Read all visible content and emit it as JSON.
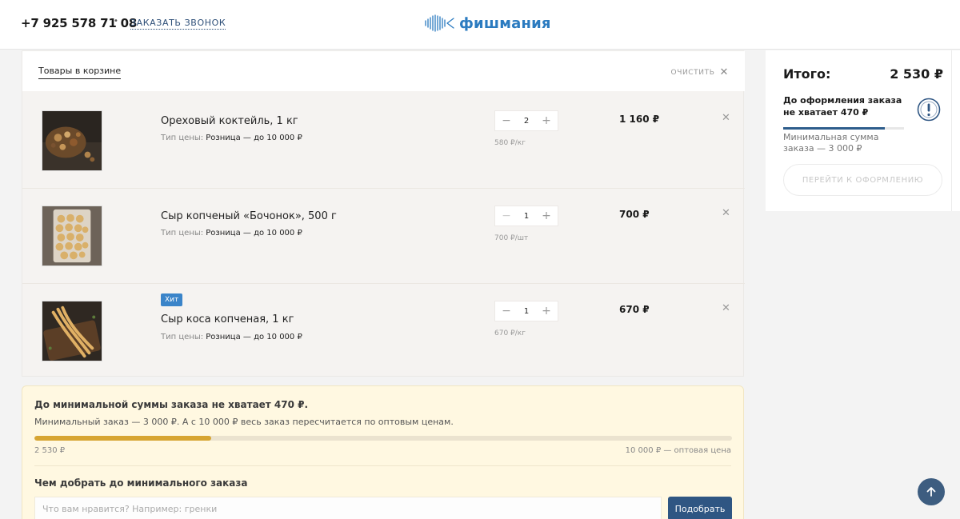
{
  "header": {
    "phone": "+7 925 578 71 08",
    "callback_label": "ЗАКАЗАТЬ ЗВОНОК",
    "logo_text": "фишмания",
    "brand_color": "#2b7bc0"
  },
  "cart": {
    "title": "Товары в корзине",
    "clear_label": "ОЧИСТИТЬ",
    "items": [
      {
        "name": "Ореховый коктейль, 1 кг",
        "badge": "",
        "price_type_label": "Тип цены:",
        "price_type_value": "Розница — до 10 000 ₽",
        "quantity": "2",
        "unit_price": "580 ₽/кг",
        "total": "1 160 ₽"
      },
      {
        "name": "Сыр копченый «Бочонок», 500 г",
        "badge": "",
        "price_type_label": "Тип цены:",
        "price_type_value": "Розница — до 10 000 ₽",
        "quantity": "1",
        "unit_price": "700 ₽/шт",
        "total": "700 ₽"
      },
      {
        "name": "Сыр коса копченая, 1 кг",
        "badge": "Хит",
        "price_type_label": "Тип цены:",
        "price_type_value": "Розница — до 10 000 ₽",
        "quantity": "1",
        "unit_price": "670 ₽/кг",
        "total": "670 ₽"
      }
    ]
  },
  "summary": {
    "total_label": "Итого:",
    "total_value": "2 530 ₽",
    "warning": "До оформления заказа не хватает 470 ₽",
    "progress_fraction": 0.843,
    "min_sum_text": "Минимальная сумма заказа — 3 000 ₽",
    "checkout_label": "ПЕРЕЙТИ К ОФОРМЛЕНИЮ"
  },
  "min_order": {
    "title": "До минимальной суммы заказа не хватает 470 ₽.",
    "description": "Минимальный заказ — 3 000 ₽. А с 10 000 ₽ весь заказ пересчитается по оптовым ценам.",
    "progress_fraction": 0.253,
    "current": "2 530 ₽",
    "target": "10 000 ₽ — оптовая цена",
    "suggest_title": "Чем добрать до минимального заказа",
    "input_placeholder": "Что вам нравится? Например: гренки",
    "button_label": "Подобрать"
  },
  "icons": {
    "minus": "minus-icon",
    "plus": "plus-icon",
    "remove": "close-icon",
    "warning": "exclamation-circle-icon",
    "scroll_top": "arrow-up-icon"
  },
  "colors": {
    "accent_dark": "#2f5683",
    "progress_gold": "#d7a532",
    "badge_blue": "#3a84c9"
  }
}
